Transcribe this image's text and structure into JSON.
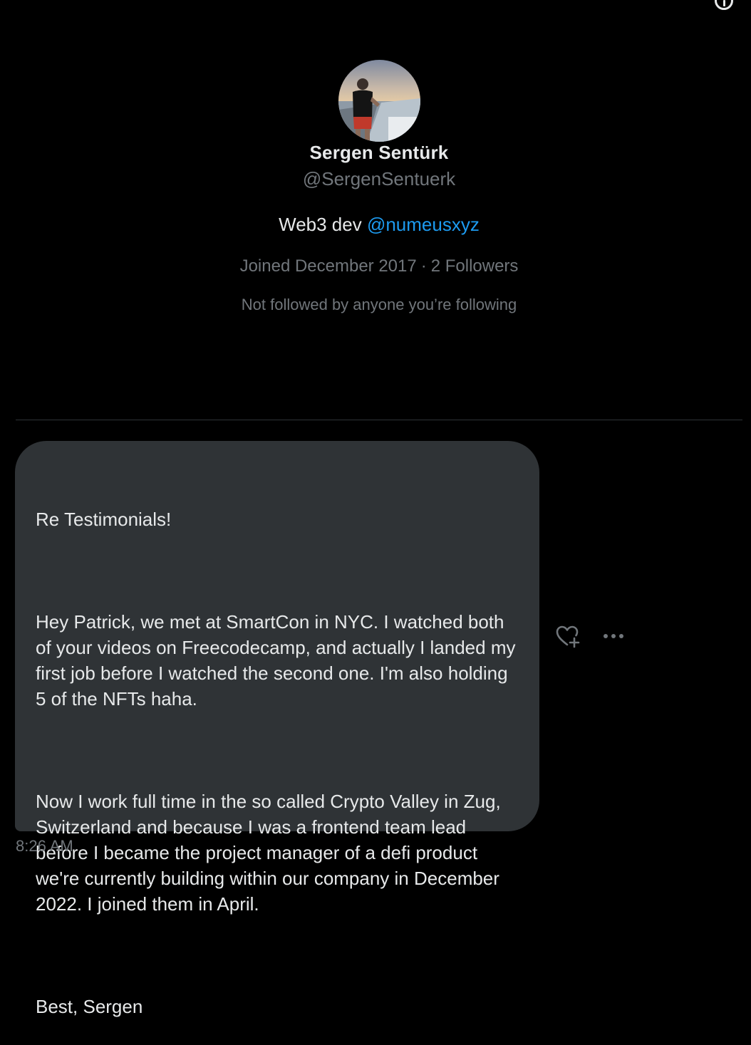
{
  "profile": {
    "display_name": "Sergen Sentürk",
    "handle": "@SergenSentuerk",
    "bio_text": "Web3 dev ",
    "bio_link": "@numeusxyz",
    "joined": "Joined December 2017",
    "separator": "·",
    "followers": "2 Followers",
    "not_followed": "Not followed by anyone you’re following"
  },
  "message": {
    "paragraphs": [
      "Re Testimonials!",
      "Hey Patrick, we met at SmartCon in NYC. I watched both of your videos on Freecodecamp, and actually I landed my first job before I watched the second one. I'm also holding 5 of the NFTs haha.",
      "Now I work full time in the so called Crypto Valley in Zug, Switzerland and because I was a frontend team lead before I became the project manager of a defi product we're currently building within our company in December 2022. I joined them in April.",
      "Best, Sergen"
    ],
    "timestamp": "8:26 AM"
  },
  "icons": {
    "info": "info-icon",
    "react": "heart-plus-icon",
    "more": "more-horizontal-icon"
  },
  "colors": {
    "background": "#000000",
    "bubble": "#2f3336",
    "text_primary": "#e7e9ea",
    "text_secondary": "#71767b",
    "link": "#1d9bf0",
    "divider": "#2f3336"
  }
}
